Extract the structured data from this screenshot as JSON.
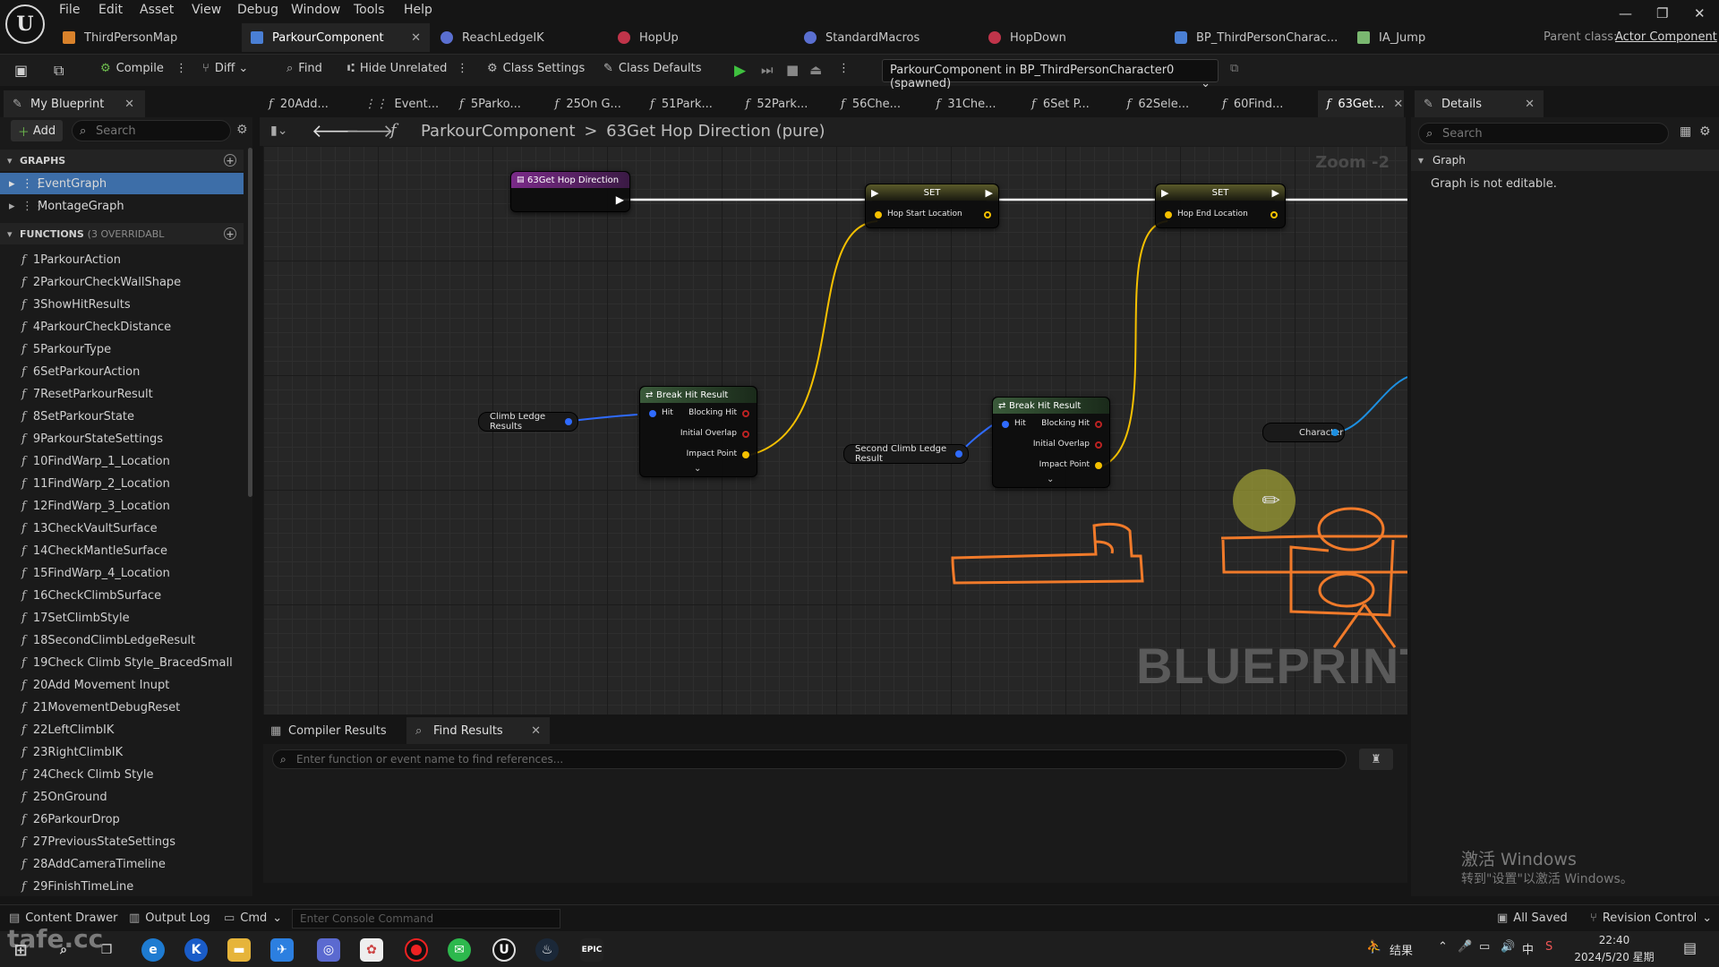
{
  "menu": [
    "File",
    "Edit",
    "Asset",
    "View",
    "Debug",
    "Window",
    "Tools",
    "Help"
  ],
  "doc_tabs": [
    {
      "label": "ThirdPersonMap",
      "color": "#d9822b"
    },
    {
      "label": "ParkourComponent",
      "color": "#4a7fd4"
    },
    {
      "label": "ReachLedgeIK",
      "color": "#5a6fd0"
    },
    {
      "label": "HopUp",
      "color": "#c0344a"
    },
    {
      "label": "StandardMacros",
      "color": "#5a6fd0"
    },
    {
      "label": "HopDown",
      "color": "#c0344a"
    },
    {
      "label": "BP_ThirdPersonCharac...",
      "color": "#4a7fd4"
    },
    {
      "label": "IA_Jump",
      "color": "#7ab870"
    }
  ],
  "parent_class": {
    "label": "Parent class:",
    "value": "Actor Component"
  },
  "toolbar": {
    "compile": "Compile",
    "diff": "Diff",
    "find": "Find",
    "hide_unrelated": "Hide Unrelated",
    "class_settings": "Class Settings",
    "class_defaults": "Class Defaults",
    "debug_object": "ParkourComponent in BP_ThirdPersonCharacter0 (spawned)"
  },
  "my_blueprint": {
    "title": "My Blueprint",
    "add": "Add",
    "search_placeholder": "Search",
    "graphs_header": "GRAPHS",
    "graphs": [
      "EventGraph",
      "MontageGraph"
    ],
    "functions_header": "FUNCTIONS",
    "functions_count": "(3 OVERRIDABL",
    "functions": [
      "1ParkourAction",
      "2ParkourCheckWallShape",
      "3ShowHitResults",
      "4ParkourCheckDistance",
      "5ParkourType",
      "6SetParkourAction",
      "7ResetParkourResult",
      "8SetParkourState",
      "9ParkourStateSettings",
      "10FindWarp_1_Location",
      "11FindWarp_2_Location",
      "12FindWarp_3_Location",
      "13CheckVaultSurface",
      "14CheckMantleSurface",
      "15FindWarp_4_Location",
      "16CheckClimbSurface",
      "17SetClimbStyle",
      "18SecondClimbLedgeResult",
      "19Check Climb Style_BracedSmall",
      "20Add Movement Inupt",
      "21MovementDebugReset",
      "22LeftClimbIK",
      "23RightClimbIK",
      "24Check Climb Style",
      "25OnGround",
      "26ParkourDrop",
      "27PreviousStateSettings",
      "28AddCameraTimeline",
      "29FinishTimeLine"
    ]
  },
  "graph_tabs": [
    "20Add...",
    "Event...",
    "5Parko...",
    "25On G...",
    "51Park...",
    "52Park...",
    "56Che...",
    "31Che...",
    "6Set P...",
    "62Sele...",
    "60Find...",
    "63Get..."
  ],
  "breadcrumb": {
    "root": "ParkourComponent",
    "sep": ">",
    "current": "63Get Hop Direction (pure)"
  },
  "zoom": "Zoom -2",
  "graph": {
    "entry_node": "63Get Hop Direction",
    "set1": {
      "title": "SET",
      "pin": "Hop Start Location"
    },
    "set2": {
      "title": "SET",
      "pin": "Hop End Location"
    },
    "break1": {
      "title": "Break Hit Result",
      "pins": [
        "Hit",
        "Blocking Hit",
        "Initial Overlap",
        "Impact Point"
      ]
    },
    "break2": {
      "title": "Break Hit Result",
      "pins": [
        "Hit",
        "Blocking Hit",
        "Initial Overlap",
        "Impact Point"
      ]
    },
    "var_climb": "Climb Ledge Results",
    "var_second": "Second Climb Ledge Result",
    "var_character": "Character",
    "watermark": "BLUEPRINT"
  },
  "bottom": {
    "tab_compiler": "Compiler Results",
    "tab_find": "Find Results",
    "find_placeholder": "Enter function or event name to find references..."
  },
  "details": {
    "title": "Details",
    "search_placeholder": "Search",
    "section": "Graph",
    "message": "Graph is not editable."
  },
  "activate_windows": {
    "line1": "激活 Windows",
    "line2": "转到\"设置\"以激活 Windows。"
  },
  "statusbar": {
    "content_drawer": "Content Drawer",
    "output_log": "Output Log",
    "cmd": "Cmd",
    "console_placeholder": "Enter Console Command",
    "all_saved": "All Saved",
    "revision_control": "Revision Control"
  },
  "taskbar": {
    "time": "22:40",
    "date": "2024/5/20 星期一",
    "ime": "中",
    "weather": "结果"
  },
  "corner_watermark": "tafe.cc",
  "colors": {
    "struct_pin": "#2f6bff",
    "vector_pin": "#f5c000",
    "exec": "#ffffff",
    "annotation": "#f07a2a",
    "object_pin": "#1d8fe0"
  }
}
